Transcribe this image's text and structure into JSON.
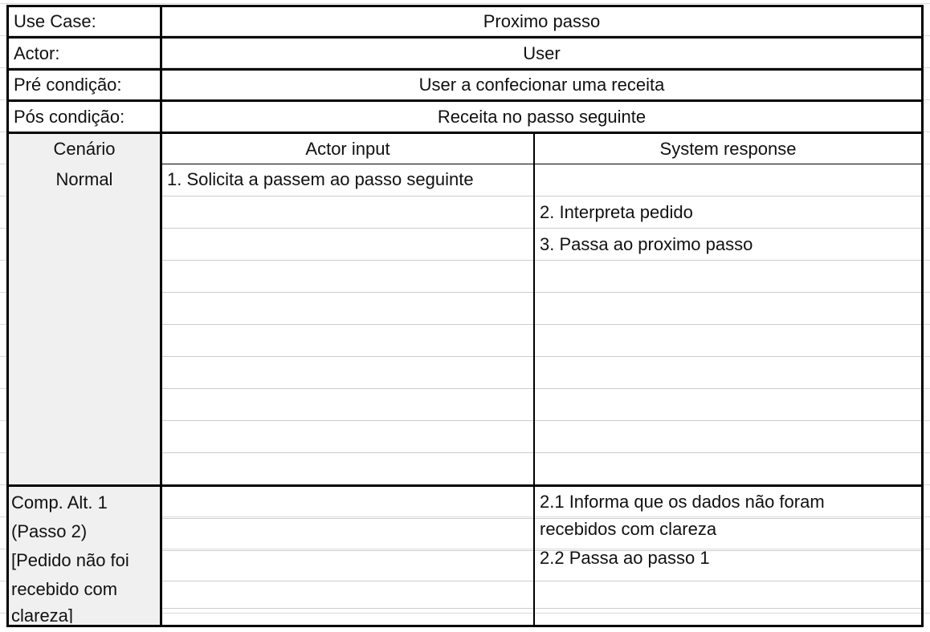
{
  "header_rows": [
    {
      "label": "Use Case:",
      "value": "Proximo passo"
    },
    {
      "label": "Actor:",
      "value": "User"
    },
    {
      "label": "Pré condição:",
      "value": "User a confecionar uma receita"
    },
    {
      "label": "Pós condição:",
      "value": "Receita no passo seguinte"
    }
  ],
  "scenario": {
    "label_lines": [
      "Cenário",
      "Normal"
    ],
    "actor_header": "Actor input",
    "system_header": "System response",
    "actor_steps": [
      "1. Solicita a passem ao passo seguinte"
    ],
    "system_steps": [
      "2. Interpreta pedido",
      "3. Passa ao proximo passo"
    ]
  },
  "alternative": {
    "label_lines": [
      "Comp. Alt. 1",
      "(Passo 2)",
      "[Pedido não foi",
      "recebido com",
      "clareza]"
    ],
    "system_steps": [
      "2.1 Informa que os dados não foram",
      "recebidos com clareza",
      "2.2 Passa ao passo 1"
    ]
  }
}
